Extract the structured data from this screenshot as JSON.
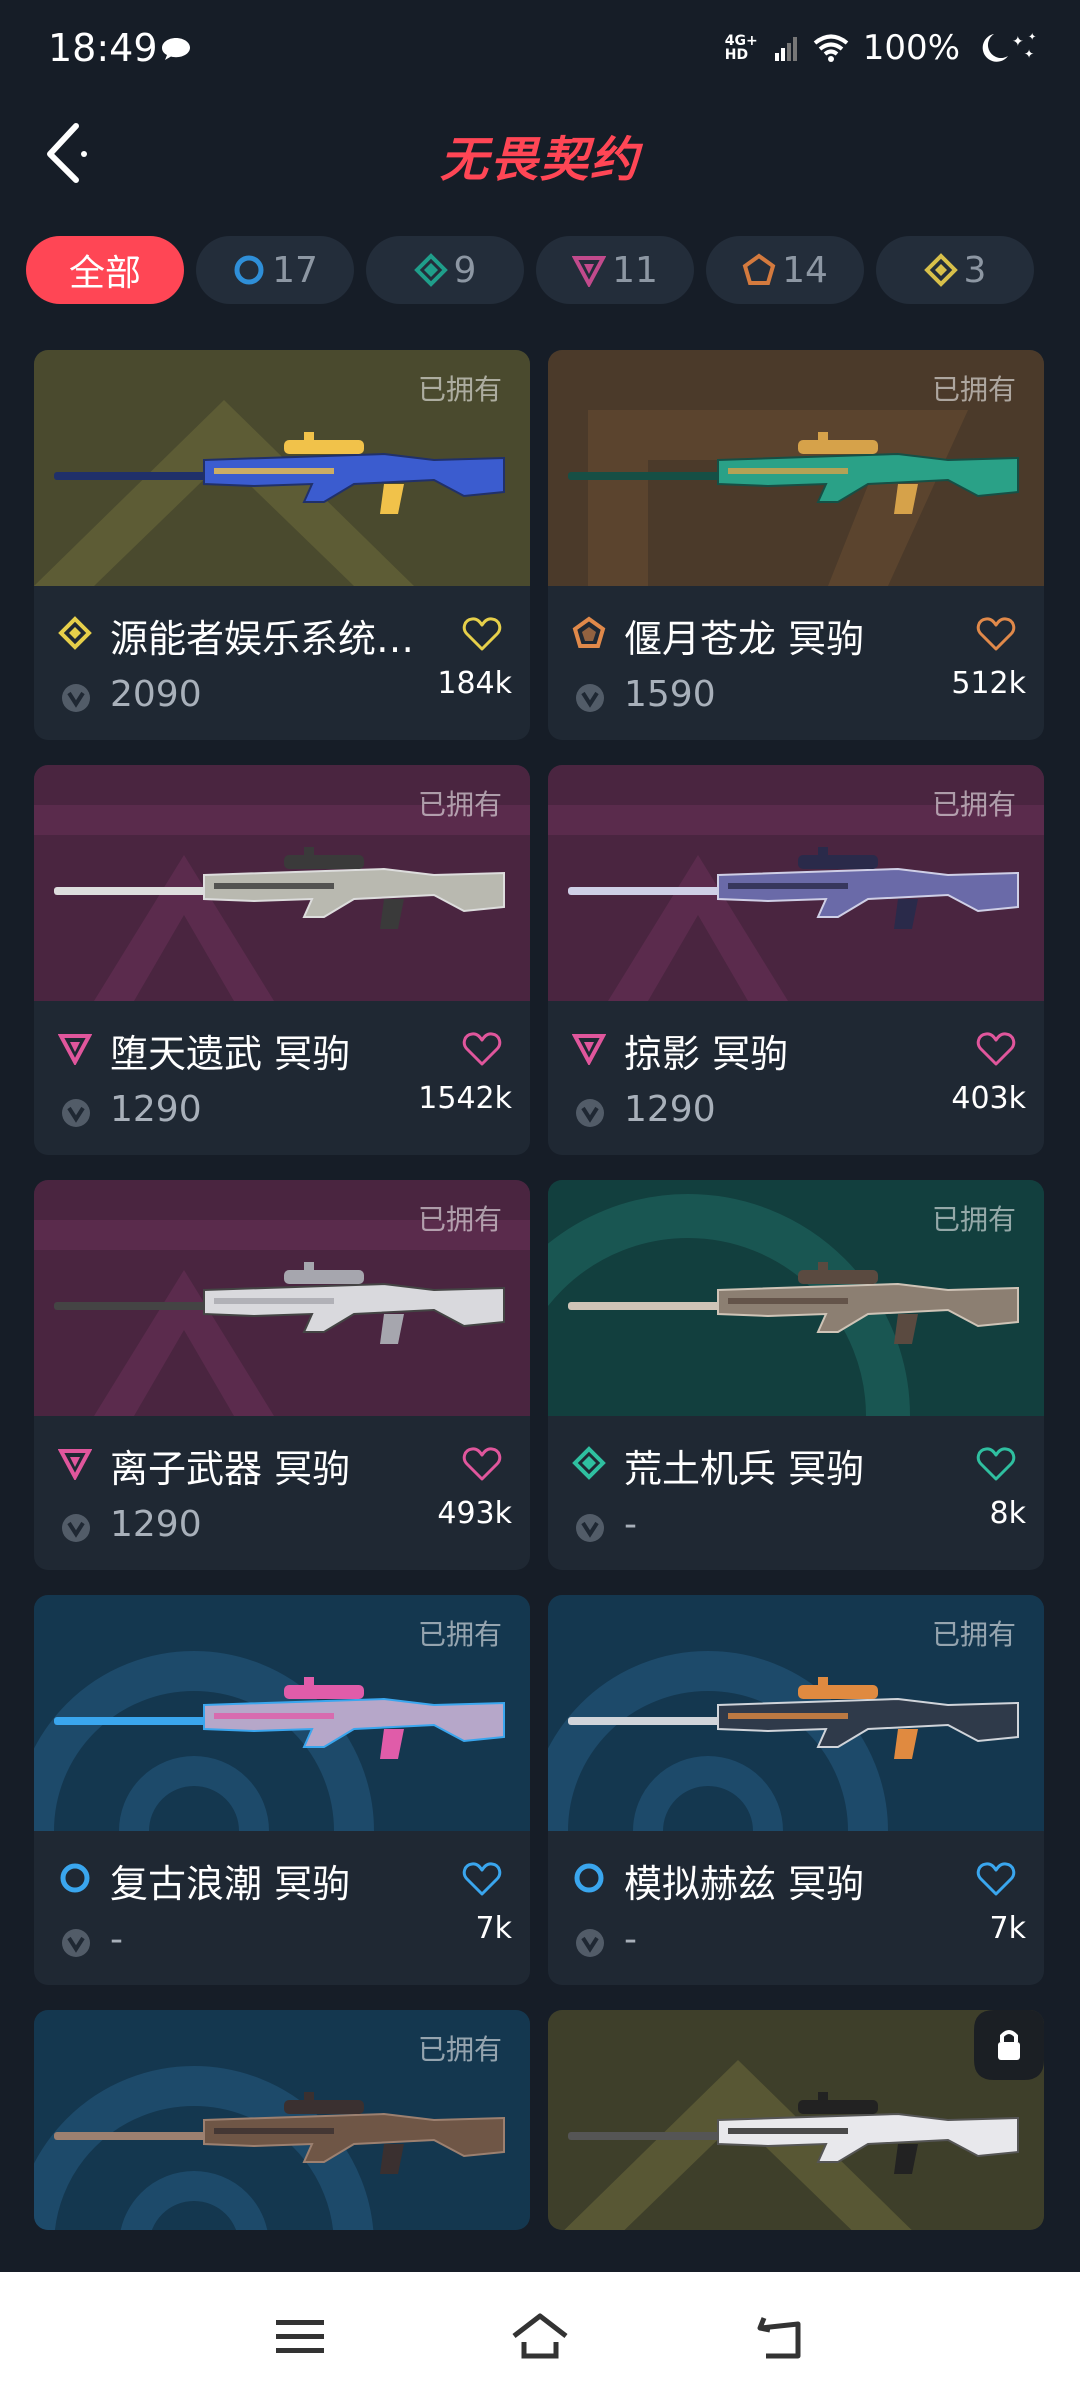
{
  "status_bar": {
    "time": "18:49",
    "network": "4G+ HD",
    "battery": "100%"
  },
  "header": {
    "title": "无畏契约"
  },
  "filters": [
    {
      "label": "全部",
      "active": true
    },
    {
      "label": "17",
      "tier": "select",
      "color": "#2f8fd8"
    },
    {
      "label": "9",
      "tier": "deluxe",
      "color": "#1f9e8a"
    },
    {
      "label": "11",
      "tier": "premium",
      "color": "#c24a8c"
    },
    {
      "label": "14",
      "tier": "exclusive",
      "color": "#d47a3e"
    },
    {
      "label": "3",
      "tier": "ultra",
      "color": "#d8c04a"
    }
  ],
  "cards": [
    {
      "name": "源能者娱乐系统…",
      "price": "2090",
      "likes": "184k",
      "owned_label": "已拥有",
      "tier": "ultra",
      "tier_color": "#e6cf4a",
      "bg": "#4a4a2e"
    },
    {
      "name": "偃月苍龙 冥驹",
      "price": "1590",
      "likes": "512k",
      "owned_label": "已拥有",
      "tier": "exclusive",
      "tier_color": "#e0894a",
      "bg": "#4b3a2a"
    },
    {
      "name": "堕天遗武 冥驹",
      "price": "1290",
      "likes": "1542k",
      "owned_label": "已拥有",
      "tier": "premium",
      "tier_color": "#e0569c",
      "bg": "#4a2540"
    },
    {
      "name": "掠影 冥驹",
      "price": "1290",
      "likes": "403k",
      "owned_label": "已拥有",
      "tier": "premium",
      "tier_color": "#e0569c",
      "bg": "#4a2540"
    },
    {
      "name": "离子武器 冥驹",
      "price": "1290",
      "likes": "493k",
      "owned_label": "已拥有",
      "tier": "premium",
      "tier_color": "#e0569c",
      "bg": "#4a2540"
    },
    {
      "name": "荒土机兵 冥驹",
      "price": "-",
      "likes": "8k",
      "owned_label": "已拥有",
      "tier": "deluxe",
      "tier_color": "#2fbfa0",
      "bg": "#123f3e"
    },
    {
      "name": "复古浪潮 冥驹",
      "price": "-",
      "likes": "7k",
      "owned_label": "已拥有",
      "tier": "select",
      "tier_color": "#3aa6ee",
      "bg": "#14374f"
    },
    {
      "name": "模拟赫兹 冥驹",
      "price": "-",
      "likes": "7k",
      "owned_label": "已拥有",
      "tier": "select",
      "tier_color": "#3aa6ee",
      "bg": "#14374f"
    },
    {
      "name": "",
      "price": "",
      "likes": "",
      "owned_label": "已拥有",
      "tier": "select",
      "tier_color": "#3aa6ee",
      "bg": "#14374f"
    },
    {
      "name": "",
      "price": "",
      "likes": "",
      "owned_label": "",
      "tier": "ultra",
      "tier_color": "#e6cf4a",
      "bg": "#3e3f2a",
      "locked": true
    }
  ]
}
